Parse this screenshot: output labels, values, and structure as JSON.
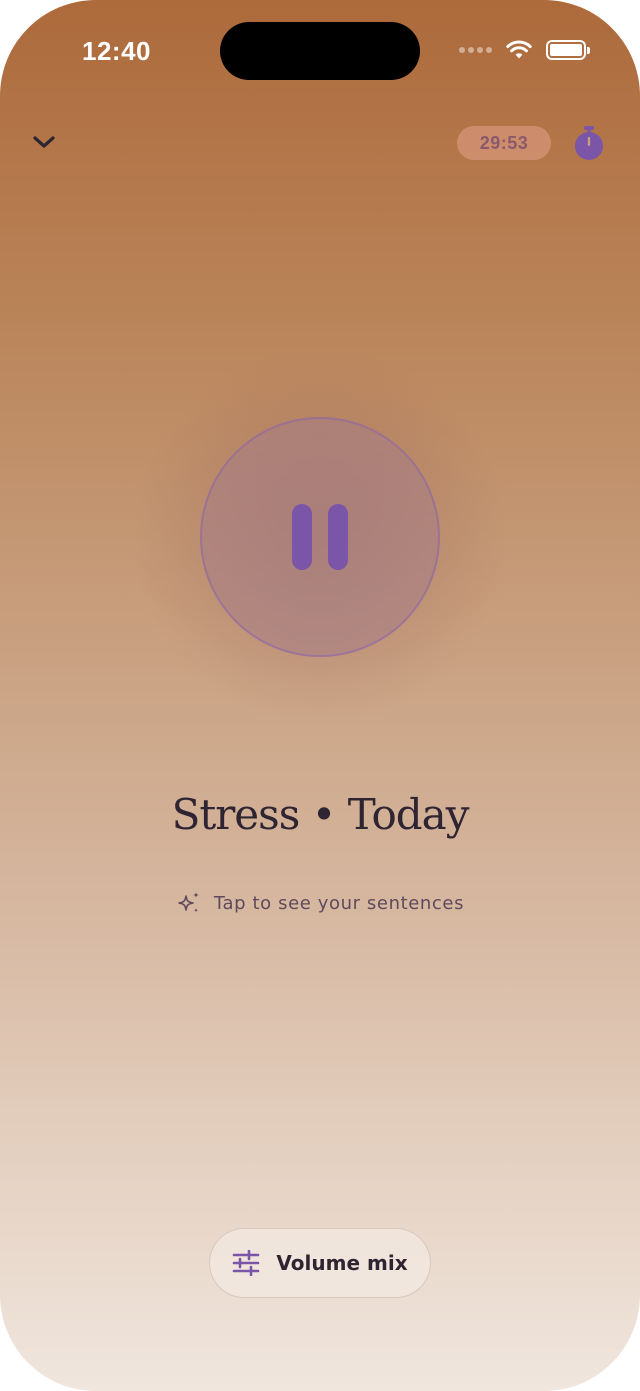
{
  "status_bar": {
    "time": "12:40"
  },
  "header": {
    "collapse_icon": "chevron-down-icon",
    "timer_remaining": "29:53",
    "timer_icon": "stopwatch-icon"
  },
  "player": {
    "state_icon": "pause-icon",
    "title": "Stress • Today",
    "hint_icon": "sparkles-icon",
    "hint_text": "Tap to see your sentences"
  },
  "footer": {
    "volume_icon": "sliders-icon",
    "volume_label": "Volume mix"
  },
  "colors": {
    "accent": "#7a55a8",
    "text_dark": "#2e2432",
    "gradient_top": "#ad6a3b",
    "gradient_bottom": "#f0e6de"
  }
}
